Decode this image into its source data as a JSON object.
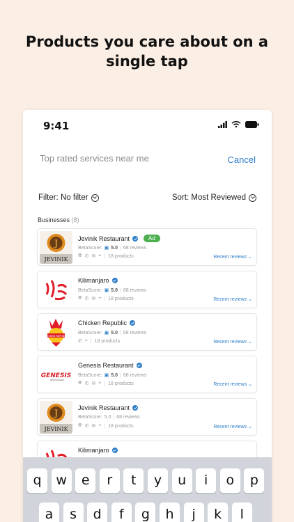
{
  "headline": {
    "line1": "Products  you care about  on a",
    "line2": "single tap"
  },
  "status_bar": {
    "time": "9:41"
  },
  "search": {
    "placeholder": "Top rated services near me",
    "cancel_label": "Cancel"
  },
  "filter": {
    "label": "Filter: No filter"
  },
  "sort": {
    "label": "Sort: Most Reviewed"
  },
  "businesses": {
    "label": "Businesses",
    "count": "(8)",
    "items": [
      {
        "name": "Jevinik Restaurant",
        "ad": "Ad",
        "score_label": "BetaScore:",
        "score": "5.0",
        "reviews": "68 reviews",
        "products": "18 products",
        "recent": "Recent reviews"
      },
      {
        "name": "Kilimanjaro",
        "score_label": "BetaScore:",
        "score": "5.0",
        "reviews": "68 reviews",
        "products": "18 products",
        "recent": "Recent reviews"
      },
      {
        "name": "Chicken Republic",
        "score_label": "BetaScore:",
        "score": "5.0",
        "reviews": "68 reviews",
        "products": "18 products",
        "recent": "Recent reviews"
      },
      {
        "name": "Genesis Restaurant",
        "score_label": "BetaScore:",
        "score": "5.0",
        "reviews": "68 reviews",
        "products": "18 products",
        "recent": "Recent reviews"
      },
      {
        "name": "Jevinik Restaurant",
        "score_label": "BetaScore:",
        "score": "5.0",
        "reviews": "68 reviews",
        "products": "18 products",
        "recent": "Recent reviews"
      },
      {
        "name": "Kilimanjaro"
      }
    ]
  },
  "logos": {
    "jevinik": "JEVINIK",
    "genesis": "GENESIS",
    "genesis_sub": "RESTAURANT",
    "chicken": "CHICKEN REPUBLIC"
  },
  "keyboard": {
    "row1": [
      "q",
      "w",
      "e",
      "r",
      "t",
      "y",
      "u",
      "i",
      "o",
      "p"
    ],
    "row2": [
      "a",
      "s",
      "d",
      "f",
      "g",
      "h",
      "j",
      "k",
      "l"
    ]
  },
  "colors": {
    "accent": "#2f7fc7",
    "ad_green": "#4caf50",
    "background": "#fbeee4"
  },
  "icons": [
    "signal-icon",
    "wifi-icon",
    "battery-icon",
    "chevron-down-icon",
    "verified-icon",
    "globe-icon",
    "phone-icon",
    "mail-icon",
    "location-icon"
  ]
}
